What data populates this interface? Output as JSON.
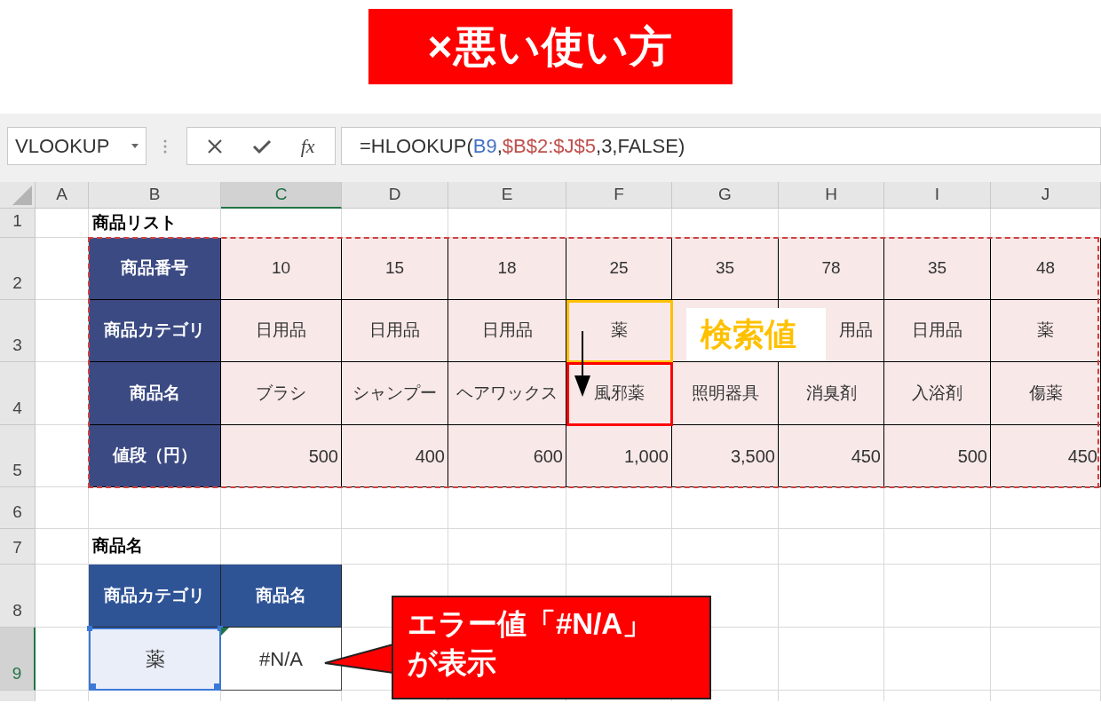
{
  "banner": {
    "title": "×悪い使い方"
  },
  "name_box": {
    "value": "VLOOKUP"
  },
  "formula_bar": {
    "fx_label": "fx",
    "formula": [
      {
        "text": "=HLOOKUP("
      },
      {
        "text": "B9",
        "color": "#4472c4"
      },
      {
        "text": ","
      },
      {
        "text": "$B$2:$J$5",
        "color": "#c0504d"
      },
      {
        "text": ",3,FALSE)"
      }
    ]
  },
  "columns": [
    {
      "label": "A",
      "selected": false
    },
    {
      "label": "B",
      "selected": false
    },
    {
      "label": "C",
      "selected": true
    },
    {
      "label": "D",
      "selected": false
    },
    {
      "label": "E",
      "selected": false
    },
    {
      "label": "F",
      "selected": false
    },
    {
      "label": "G",
      "selected": false
    },
    {
      "label": "H",
      "selected": false
    },
    {
      "label": "I",
      "selected": false
    },
    {
      "label": "J",
      "selected": false
    }
  ],
  "rows": [
    {
      "number": "1",
      "selected": false,
      "cells": [
        null,
        {
          "kind": "title",
          "text": "商品リスト"
        },
        null,
        null,
        null,
        null,
        null,
        null,
        null,
        null
      ]
    },
    {
      "number": "2",
      "selected": false,
      "cells": [
        null,
        {
          "kind": "table-header",
          "text": "商品番号"
        },
        {
          "kind": "data",
          "text": "10"
        },
        {
          "kind": "data",
          "text": "15"
        },
        {
          "kind": "data",
          "text": "18"
        },
        {
          "kind": "data",
          "text": "25"
        },
        {
          "kind": "data",
          "text": "35"
        },
        {
          "kind": "data",
          "text": "78"
        },
        {
          "kind": "data",
          "text": "35"
        },
        {
          "kind": "data",
          "text": "48"
        }
      ]
    },
    {
      "number": "3",
      "selected": false,
      "cells": [
        null,
        {
          "kind": "table-header",
          "text": "商品カテゴリ"
        },
        {
          "kind": "data",
          "text": "日用品"
        },
        {
          "kind": "data",
          "text": "日用品"
        },
        {
          "kind": "data",
          "text": "日用品"
        },
        {
          "kind": "data",
          "text": "薬"
        },
        {
          "kind": "data-covered"
        },
        {
          "kind": "data-right",
          "text": "用品"
        },
        {
          "kind": "data",
          "text": "日用品"
        },
        {
          "kind": "data",
          "text": "薬"
        }
      ]
    },
    {
      "number": "4",
      "selected": false,
      "cells": [
        null,
        {
          "kind": "table-header",
          "text": "商品名"
        },
        {
          "kind": "data",
          "text": "ブラシ"
        },
        {
          "kind": "data",
          "text": "シャンプー"
        },
        {
          "kind": "data",
          "text": "ヘアワックス"
        },
        {
          "kind": "data",
          "text": "風邪薬"
        },
        {
          "kind": "data",
          "text": "照明器具"
        },
        {
          "kind": "data",
          "text": "消臭剤"
        },
        {
          "kind": "data",
          "text": "入浴剤"
        },
        {
          "kind": "data",
          "text": "傷薬"
        }
      ]
    },
    {
      "number": "5",
      "selected": false,
      "cells": [
        null,
        {
          "kind": "table-header",
          "text": "値段（円）"
        },
        {
          "kind": "number",
          "text": "500"
        },
        {
          "kind": "number",
          "text": "400"
        },
        {
          "kind": "number",
          "text": "600"
        },
        {
          "kind": "number",
          "text": "1,000"
        },
        {
          "kind": "number",
          "text": "3,500"
        },
        {
          "kind": "number",
          "text": "450"
        },
        {
          "kind": "number",
          "text": "500"
        },
        {
          "kind": "number",
          "text": "450"
        }
      ]
    },
    {
      "number": "6",
      "selected": false,
      "cells": [
        null,
        null,
        null,
        null,
        null,
        null,
        null,
        null,
        null,
        null
      ]
    },
    {
      "number": "7",
      "selected": false,
      "cells": [
        null,
        {
          "kind": "title",
          "text": "商品名"
        },
        null,
        null,
        null,
        null,
        null,
        null,
        null,
        null
      ]
    },
    {
      "number": "8",
      "selected": false,
      "cells": [
        null,
        {
          "kind": "form-header",
          "text": "商品カテゴリ"
        },
        {
          "kind": "form-header",
          "text": "商品名"
        },
        null,
        null,
        null,
        null,
        null,
        null,
        null
      ]
    },
    {
      "number": "9",
      "selected": true,
      "cells": [
        null,
        {
          "kind": "input",
          "text": "薬"
        },
        {
          "kind": "formula",
          "text": "#N/A"
        },
        null,
        {
          "kind": "covered"
        },
        {
          "kind": "covered"
        },
        null,
        null,
        null,
        null
      ]
    }
  ],
  "annotations": {
    "lookup_label": "検索値",
    "callout": "エラー値「#N/A」が表示"
  }
}
